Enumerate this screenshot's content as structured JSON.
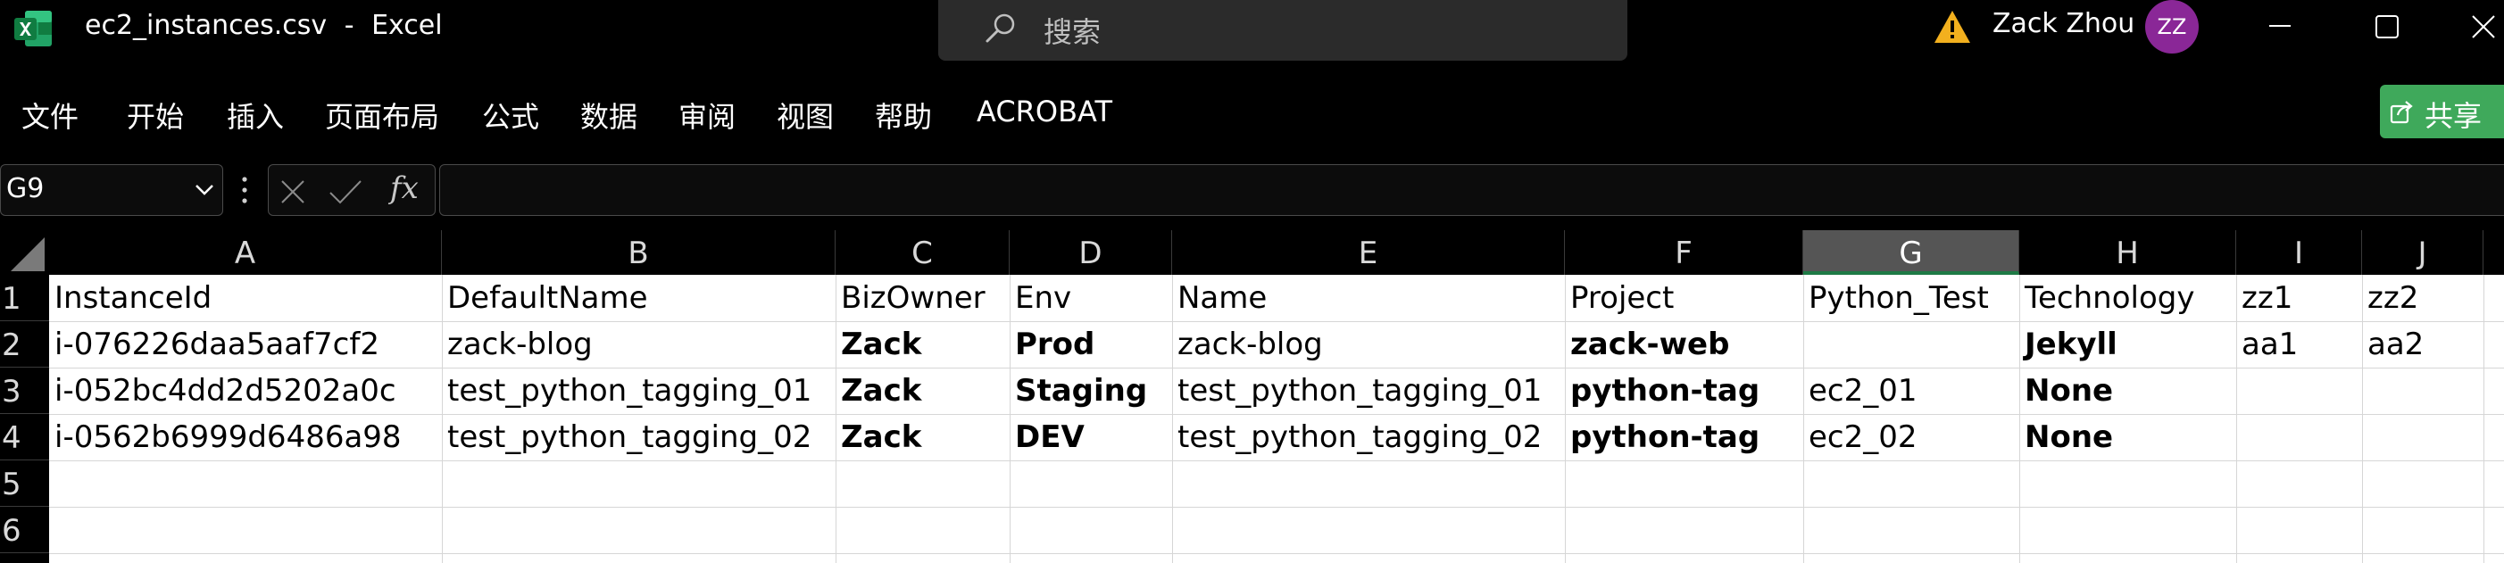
{
  "app": {
    "file_name": "ec2_instances.csv",
    "separator": "-",
    "app_name": "Excel",
    "search_placeholder": "搜索",
    "user_name": "Zack Zhou",
    "user_initials": "ZZ"
  },
  "ribbon": {
    "tabs": [
      "文件",
      "开始",
      "插入",
      "页面布局",
      "公式",
      "数据",
      "审阅",
      "视图",
      "帮助",
      "ACROBAT"
    ],
    "share_label": "共享"
  },
  "formula_bar": {
    "name_box": "G9",
    "fx_label": "fx",
    "formula": ""
  },
  "sheet": {
    "columns": [
      "A",
      "B",
      "C",
      "D",
      "E",
      "F",
      "G",
      "H",
      "I",
      "J"
    ],
    "row_numbers": [
      "1",
      "2",
      "3",
      "4",
      "5",
      "6"
    ],
    "selected_column": "G",
    "rows": [
      [
        "InstanceId",
        "DefaultName",
        "BizOwner",
        "Env",
        "Name",
        "Project",
        "Python_Test",
        "Technology",
        "zz1",
        "zz2"
      ],
      [
        "i-076226daa5aaf7cf2",
        "zack-blog",
        "Zack",
        "Prod",
        "zack-blog",
        "zack-web",
        "",
        "Jekyll",
        "aa1",
        "aa2"
      ],
      [
        "i-052bc4dd2d5202a0c",
        "test_python_tagging_01",
        "Zack",
        "Staging",
        "test_python_tagging_01",
        "python-tag",
        "ec2_01",
        "None",
        "",
        ""
      ],
      [
        "i-0562b6999d6486a98",
        "test_python_tagging_02",
        "Zack",
        "DEV",
        "test_python_tagging_02",
        "python-tag",
        "ec2_02",
        "None",
        "",
        ""
      ],
      [
        "",
        "",
        "",
        "",
        "",
        "",
        "",
        "",
        "",
        ""
      ],
      [
        "",
        "",
        "",
        "",
        "",
        "",
        "",
        "",
        "",
        ""
      ]
    ],
    "bold_columns": [
      "C",
      "D",
      "F",
      "H"
    ]
  },
  "colors": {
    "excel_green": "#1e7a45",
    "share_green": "#3fa95b",
    "avatar_purple": "#8a2797",
    "warning_yellow": "#f2b01e"
  }
}
